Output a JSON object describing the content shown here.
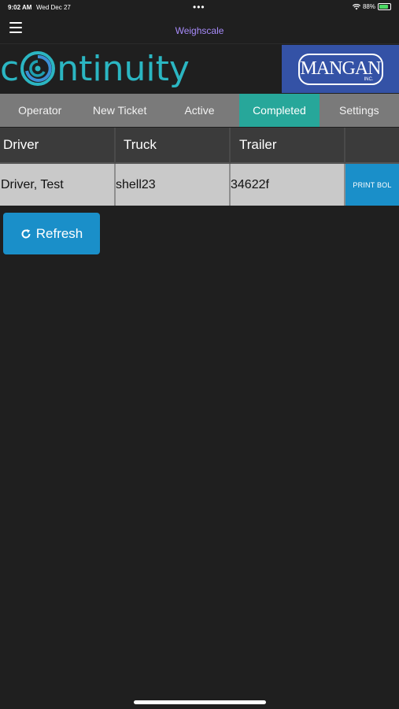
{
  "status_bar": {
    "time": "9:02 AM",
    "date": "Wed Dec 27",
    "dots": "•••",
    "battery": "88%",
    "battery_level": 0.88
  },
  "nav": {
    "title": "Weighscale",
    "menu_icon": "hamburger-menu-icon"
  },
  "brand": {
    "logo_prefix": "c",
    "logo_suffix": "ntinuity",
    "partner_logo": "MANGAN",
    "partner_logo_suffix": "INC."
  },
  "tabs": [
    {
      "label": "Operator"
    },
    {
      "label": "New Ticket"
    },
    {
      "label": "Active"
    },
    {
      "label": "Completed",
      "active": true
    },
    {
      "label": "Settings"
    }
  ],
  "table": {
    "columns": [
      "Driver",
      "Truck",
      "Trailer",
      ""
    ],
    "rows": [
      {
        "driver": "Driver, Test",
        "truck": "shell23",
        "trailer": "34622f",
        "action": "PRINT BOL"
      }
    ]
  },
  "refresh_button": {
    "label": "Refresh",
    "icon": "refresh-icon"
  },
  "colors": {
    "background": "#1f1f1f",
    "accent_teal": "#27a79a",
    "button_blue": "#1a8fc9",
    "title_purple": "#a78bfa",
    "brand_blue": "#3452a6"
  }
}
